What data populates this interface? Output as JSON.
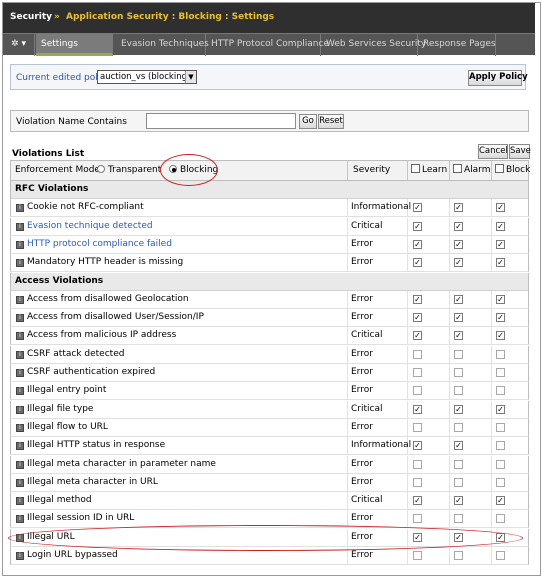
{
  "breadcrumb": {
    "security": "Security",
    "separator": "»",
    "path": "Application Security : Blocking : Settings"
  },
  "tabs": {
    "gear_icon": "gear-icon",
    "items": [
      "Settings",
      "Evasion Techniques",
      "HTTP Protocol Compliance",
      "Web Services Security",
      "Response Pages"
    ],
    "active": "Settings"
  },
  "policy": {
    "label": "Current edited policy",
    "selected": "auction_vs (blocking)",
    "apply_label": "Apply Policy"
  },
  "filter": {
    "label": "Violation Name Contains",
    "value": "",
    "go_label": "Go",
    "reset_label": "Reset"
  },
  "violations": {
    "title": "Violations List",
    "cancel_label": "Cancel",
    "save_label": "Save",
    "enforcement_label": "Enforcement Mode:",
    "mode_transparent": "Transparent",
    "mode_blocking": "Blocking",
    "selected_mode": "Blocking",
    "col_severity": "Severity",
    "col_learn": "Learn",
    "col_alarm": "Alarm",
    "col_block": "Block",
    "groups": [
      {
        "name": "RFC Violations",
        "rows": [
          {
            "name": "Cookie not RFC-compliant",
            "link": false,
            "severity": "Informational",
            "learn": true,
            "alarm": true,
            "block": true
          },
          {
            "name": "Evasion technique detected",
            "link": true,
            "severity": "Critical",
            "learn": true,
            "alarm": true,
            "block": true
          },
          {
            "name": "HTTP protocol compliance failed",
            "link": true,
            "severity": "Error",
            "learn": true,
            "alarm": true,
            "block": true
          },
          {
            "name": "Mandatory HTTP header is missing",
            "link": false,
            "severity": "Error",
            "learn": true,
            "alarm": true,
            "block": true
          }
        ]
      },
      {
        "name": "Access Violations",
        "rows": [
          {
            "name": "Access from disallowed Geolocation",
            "link": false,
            "severity": "Error",
            "learn": true,
            "alarm": true,
            "block": true
          },
          {
            "name": "Access from disallowed User/Session/IP",
            "link": false,
            "severity": "Error",
            "learn": true,
            "alarm": true,
            "block": true
          },
          {
            "name": "Access from malicious IP address",
            "link": false,
            "severity": "Critical",
            "learn": true,
            "alarm": true,
            "block": true
          },
          {
            "name": "CSRF attack detected",
            "link": false,
            "severity": "Error",
            "learn": false,
            "alarm": false,
            "block": false
          },
          {
            "name": "CSRF authentication expired",
            "link": false,
            "severity": "Error",
            "learn": false,
            "alarm": false,
            "block": false
          },
          {
            "name": "Illegal entry point",
            "link": false,
            "severity": "Error",
            "learn": false,
            "alarm": false,
            "block": false
          },
          {
            "name": "Illegal file type",
            "link": false,
            "severity": "Critical",
            "learn": true,
            "alarm": true,
            "block": true
          },
          {
            "name": "Illegal flow to URL",
            "link": false,
            "severity": "Error",
            "learn": false,
            "alarm": false,
            "block": false
          },
          {
            "name": "Illegal HTTP status in response",
            "link": false,
            "severity": "Informational",
            "learn": true,
            "alarm": true,
            "block": false
          },
          {
            "name": "Illegal meta character in parameter name",
            "link": false,
            "severity": "Error",
            "learn": false,
            "alarm": false,
            "block": false
          },
          {
            "name": "Illegal meta character in URL",
            "link": false,
            "severity": "Error",
            "learn": false,
            "alarm": false,
            "block": false
          },
          {
            "name": "Illegal method",
            "link": false,
            "severity": "Critical",
            "learn": true,
            "alarm": true,
            "block": true
          },
          {
            "name": "Illegal session ID in URL",
            "link": false,
            "severity": "Error",
            "learn": false,
            "alarm": false,
            "block": false
          },
          {
            "name": "Illegal URL",
            "link": false,
            "severity": "Error",
            "learn": true,
            "alarm": true,
            "block": true
          },
          {
            "name": "Login URL bypassed",
            "link": false,
            "severity": "Error",
            "learn": false,
            "alarm": false,
            "block": false
          }
        ]
      }
    ]
  }
}
